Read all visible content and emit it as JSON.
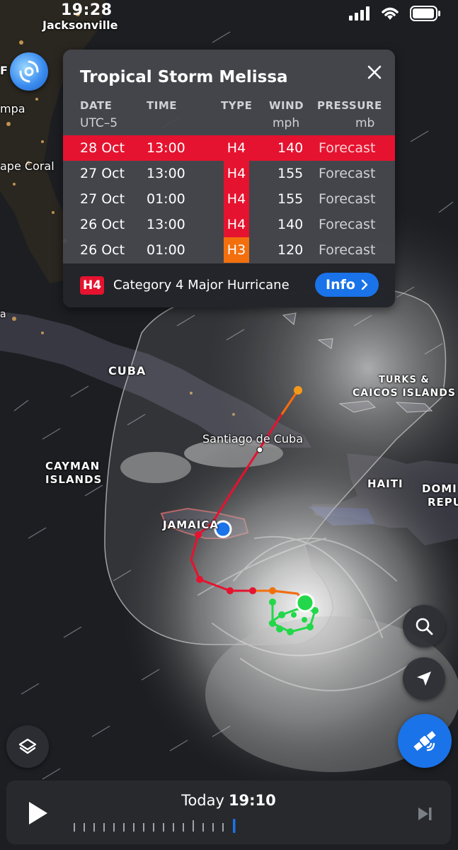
{
  "status_bar": {
    "time": "19:28",
    "icons": [
      "cellular-icon",
      "wifi-icon",
      "battery-icon"
    ]
  },
  "map_labels": {
    "jacksonville": "Jacksonville",
    "tampa": "mpa",
    "cape_coral": "ape Coral",
    "cuba": "CUBA",
    "santiago": "Santiago de Cuba",
    "cayman_1": "CAYMAN",
    "cayman_2": "ISLANDS",
    "jamaica": "JAMAICA",
    "turks_1": "TURKS &",
    "turks_2": "CAICOS ISLANDS",
    "haiti": "HAITI",
    "domi_1": "DOMI",
    "domi_2": "REPU",
    "left_edge_f": "F",
    "left_edge_a": "a"
  },
  "storm_panel": {
    "title": "Tropical Storm Melissa",
    "headers": {
      "date": "DATE",
      "time": "TIME",
      "type": "TYPE",
      "wind": "WIND",
      "pressure": "PRESSURE"
    },
    "subheaders": {
      "date": "UTC–5",
      "wind": "mph",
      "pressure": "mb"
    },
    "rows": [
      {
        "date": "28 Oct",
        "time": "13:00",
        "type": "H4",
        "wind": "140",
        "pressure": "Forecast",
        "type_color": "#e5132f"
      },
      {
        "date": "27 Oct",
        "time": "13:00",
        "type": "H4",
        "wind": "155",
        "pressure": "Forecast",
        "type_color": "#e5132f"
      },
      {
        "date": "27 Oct",
        "time": "01:00",
        "type": "H4",
        "wind": "155",
        "pressure": "Forecast",
        "type_color": "#e5132f"
      },
      {
        "date": "26 Oct",
        "time": "13:00",
        "type": "H4",
        "wind": "140",
        "pressure": "Forecast",
        "type_color": "#e5132f"
      },
      {
        "date": "26 Oct",
        "time": "01:00",
        "type": "H3",
        "wind": "120",
        "pressure": "Forecast",
        "type_color": "#f36f0e"
      }
    ],
    "legend_badge": "H4",
    "legend_text": "Category 4 Major Hurricane",
    "info_label": "Info"
  },
  "player": {
    "day": "Today",
    "time": "19:10"
  },
  "colors": {
    "accent": "#1a73e8",
    "h4": "#e5132f",
    "h3": "#f36f0e",
    "track_current": "#22d84a"
  }
}
